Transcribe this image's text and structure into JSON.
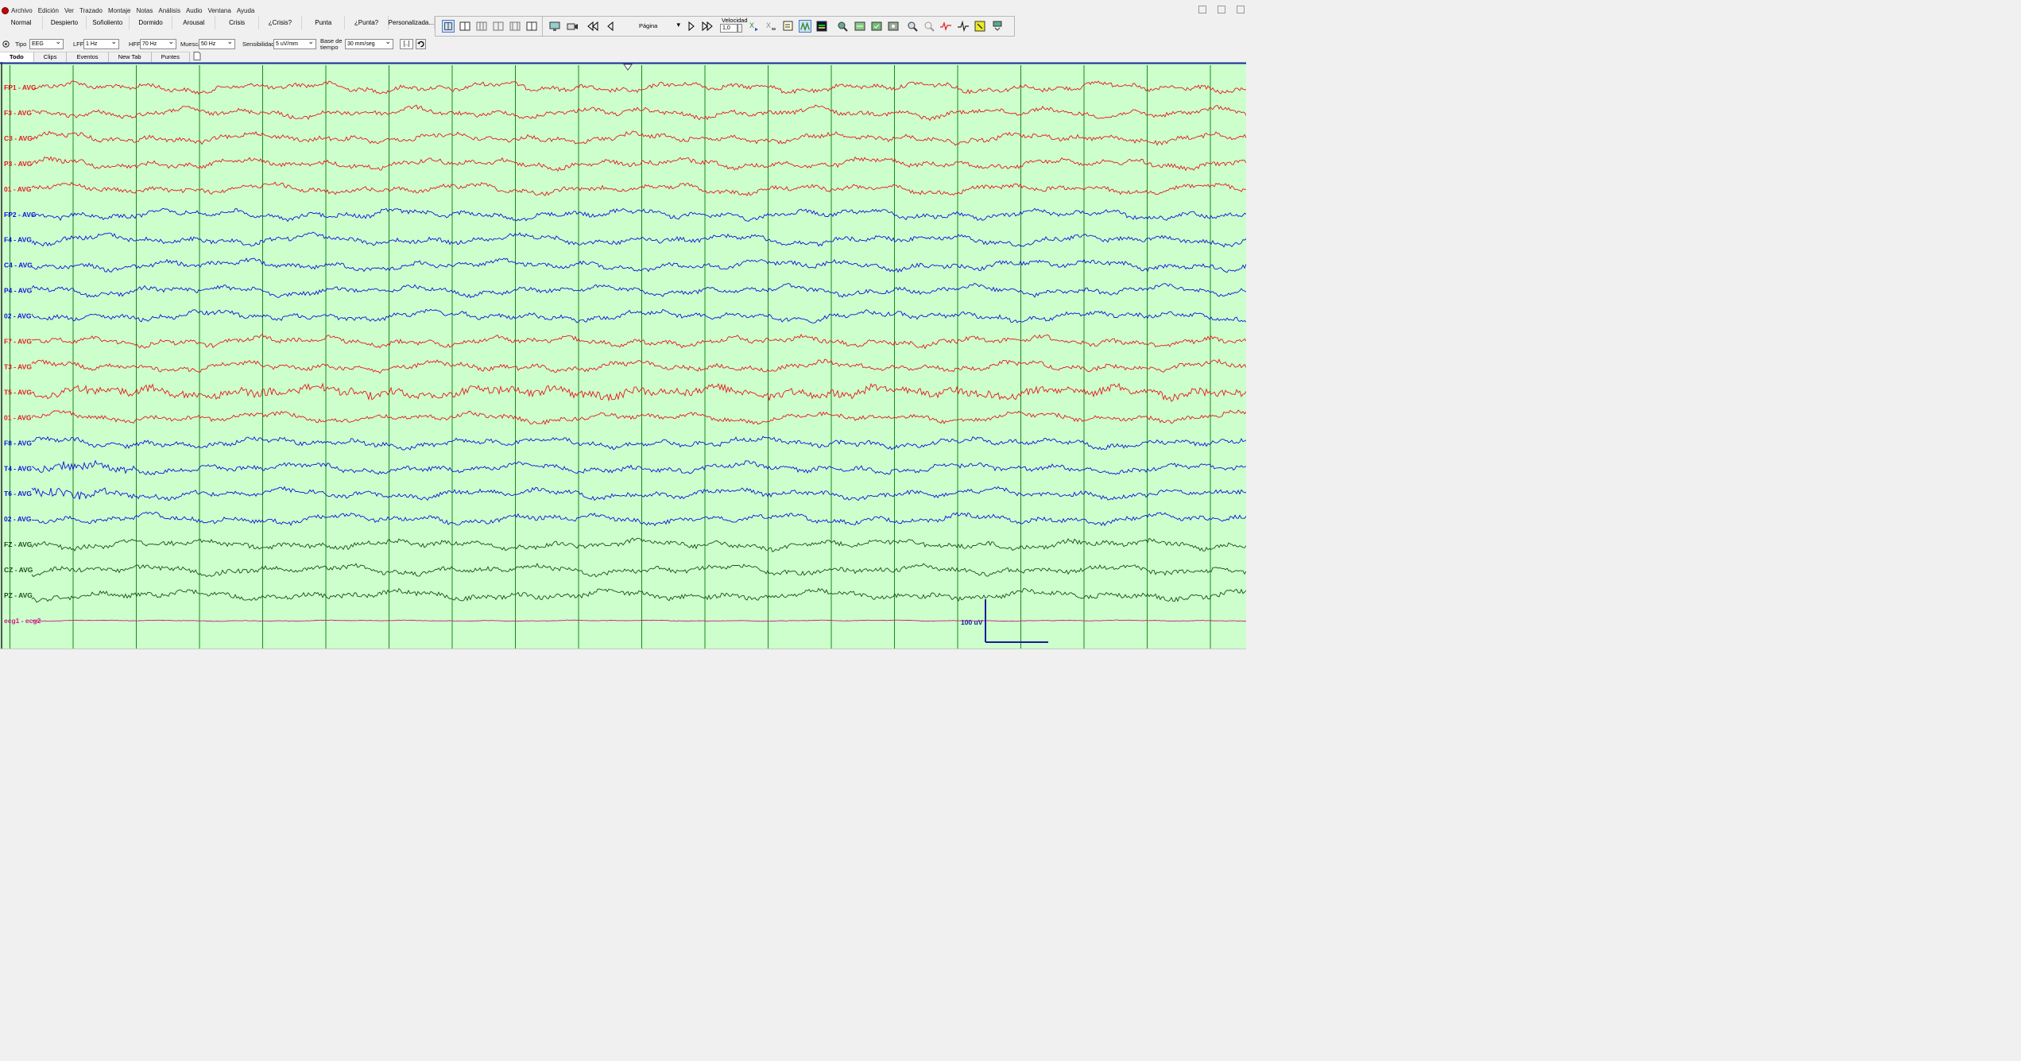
{
  "menu": [
    "Archivo",
    "Edición",
    "Ver",
    "Trazado",
    "Montaje",
    "Notas",
    "Análisis",
    "Audio",
    "Ventana",
    "Ayuda"
  ],
  "state_buttons": [
    "Normal",
    "Despierto",
    "Soñoliento",
    "Dormido",
    "Arousal",
    "Crisis",
    "¿Crisis?",
    "Punta",
    "¿Punta?",
    "Personalizada..."
  ],
  "toolbar": {
    "page_select": "Página",
    "velocidad_label": "Velocidad",
    "velocidad_value": "1,0"
  },
  "settings": {
    "tipo_label": "Tipo",
    "tipo_value": "EEG",
    "lff_label": "LFF",
    "lff_value": "1 Hz",
    "hff_label": "HFF",
    "hff_value": "70 Hz",
    "muesca_label": "Muesca",
    "muesca_value": "50 Hz",
    "sens_label": "Sensibilidad",
    "sens_value": "5 uV/mm",
    "base_label_1": "Base de",
    "base_label_2": "tiempo",
    "base_value": "30 mm/seg",
    "bracket_btn": "[..]"
  },
  "tabs": [
    "Todo",
    "Clips",
    "Eventos",
    "New Tab",
    "Puntes"
  ],
  "active_tab": "Todo",
  "colors": {
    "background": "#ccffcc",
    "red_channel": "#e8171b",
    "blue_channel": "#1010dd",
    "green_channel": "#174f17",
    "ecg_channel": "#d4188a",
    "gridline": "#1b8a1b",
    "top_line": "#1c28a0",
    "calibration": "#1c1c9a"
  },
  "channels": [
    {
      "label": "FP1 - AVG",
      "color": "red"
    },
    {
      "label": "F3 - AVG",
      "color": "red"
    },
    {
      "label": "C3 - AVG",
      "color": "red"
    },
    {
      "label": "P3 - AVG",
      "color": "red"
    },
    {
      "label": "01 - AVG",
      "color": "red"
    },
    {
      "label": "FP2 - AVG",
      "color": "blue"
    },
    {
      "label": "F4 - AVG",
      "color": "blue"
    },
    {
      "label": "C4 - AVG",
      "color": "blue"
    },
    {
      "label": "P4 - AVG",
      "color": "blue"
    },
    {
      "label": "02 - AVG",
      "color": "blue"
    },
    {
      "label": "F7 - AVG",
      "color": "red"
    },
    {
      "label": "T3 - AVG",
      "color": "red"
    },
    {
      "label": "T5 - AVG",
      "color": "red"
    },
    {
      "label": "01 - AVG",
      "color": "red"
    },
    {
      "label": "F8 - AVG",
      "color": "blue"
    },
    {
      "label": "T4 - AVG",
      "color": "blue"
    },
    {
      "label": "T6 - AVG",
      "color": "blue"
    },
    {
      "label": "02 - AVG",
      "color": "blue"
    },
    {
      "label": "FZ - AVG",
      "color": "green"
    },
    {
      "label": "CZ - AVG",
      "color": "green"
    },
    {
      "label": "PZ - AVG",
      "color": "green"
    },
    {
      "label": "ecg1 - ecg2",
      "color": "ecg"
    }
  ],
  "calibration_label": "100 uV"
}
